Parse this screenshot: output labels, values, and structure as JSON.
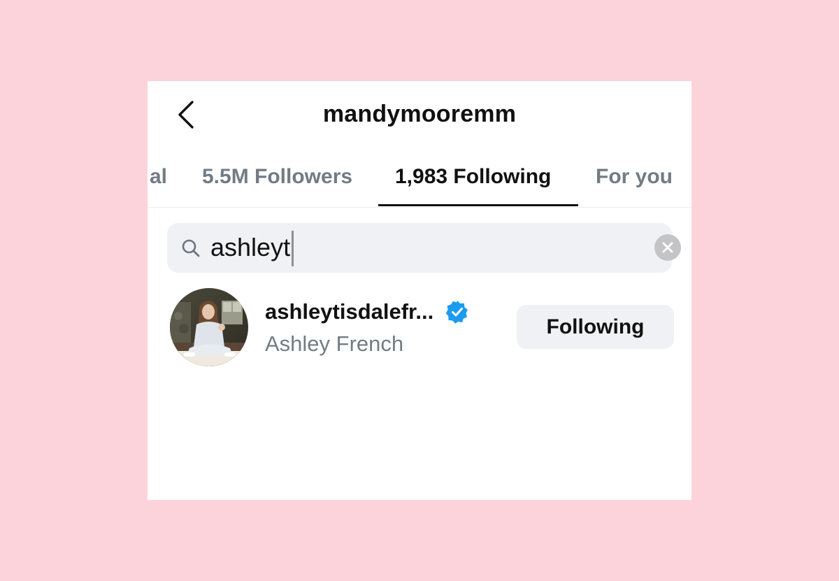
{
  "header": {
    "title": "mandymooremm",
    "back_icon": "chevron-left-icon"
  },
  "tabs": [
    {
      "label": "al",
      "active": false
    },
    {
      "label": "5.5M Followers",
      "active": false
    },
    {
      "label": "1,983 Following",
      "active": true
    },
    {
      "label": "For you",
      "active": false
    }
  ],
  "search": {
    "value": "ashleyt",
    "icon": "search-icon",
    "clear_icon": "clear-icon"
  },
  "results": [
    {
      "username": "ashleytisdalefr...",
      "full_name": "Ashley French",
      "verified": true,
      "button_label": "Following"
    }
  ],
  "colors": {
    "background": "#fdd3db",
    "verified": "#1d9bf0",
    "muted_text": "#737b84",
    "button_bg": "#eff1f4"
  }
}
